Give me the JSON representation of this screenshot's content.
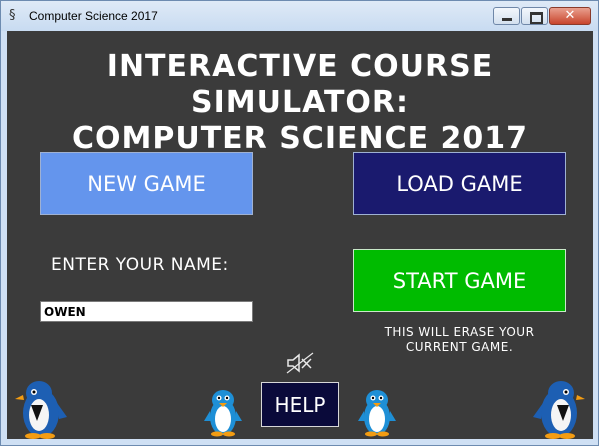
{
  "window": {
    "title": "Computer Science 2017",
    "controls": {
      "minimize": "minimize-icon",
      "maximize": "maximize-icon",
      "close": "close-icon"
    }
  },
  "heading": {
    "line1": "INTERACTIVE COURSE SIMULATOR:",
    "line2": "COMPUTER SCIENCE 2017"
  },
  "buttons": {
    "new_game": "NEW GAME",
    "load_game": "LOAD GAME",
    "start_game": "START GAME",
    "help": "HELP"
  },
  "name_prompt": "ENTER YOUR NAME:",
  "name_value": "OWEN",
  "erase_note": {
    "line1": "THIS WILL ERASE YOUR",
    "line2": "CURRENT GAME."
  },
  "icons": {
    "mute": "speaker-muted-icon",
    "mascot": "penguin-icon"
  },
  "colors": {
    "background": "#3b3b3b",
    "new_game": "#6495ed",
    "load_game": "#1a1a6e",
    "start_game": "#00bb00",
    "help": "#0a0a3a",
    "penguin": "#1d5fb3"
  }
}
